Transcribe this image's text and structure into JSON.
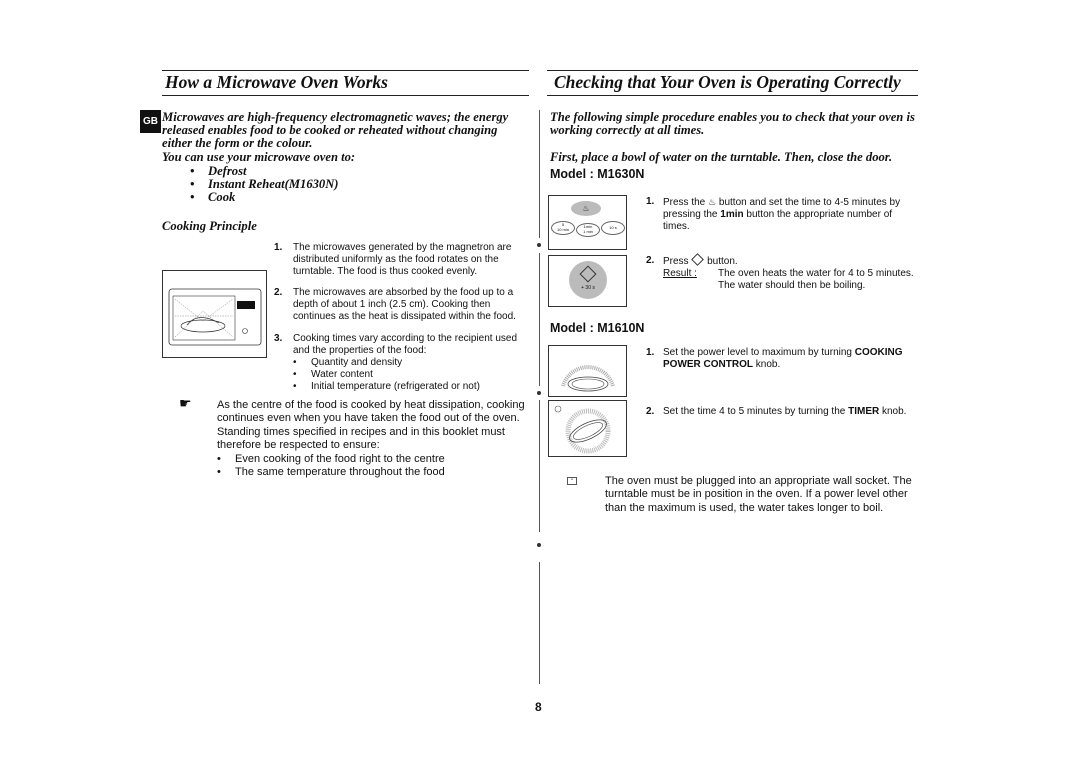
{
  "lang_badge": "GB",
  "left": {
    "title": "How a Microwave Oven Works",
    "intro": [
      "Microwaves are high-frequency electromagnetic waves; the energy",
      "released enables food to be cooked or reheated without changing",
      "either the form or the colour."
    ],
    "uses_heading": "You can use your microwave oven to:",
    "uses": [
      "Defrost",
      "Instant Reheat(M1630N)",
      "Cook"
    ],
    "subheading": "Cooking Principle",
    "steps": [
      {
        "num": "1.",
        "lines": [
          "The microwaves generated by the magnetron are",
          "distributed uniformly as the food rotates on the",
          "turntable. The food is thus cooked evenly."
        ]
      },
      {
        "num": "2.",
        "lines": [
          "The microwaves are absorbed by the food up to a",
          "depth of about 1 inch (2.5 cm). Cooking then",
          "continues as the heat is dissipated within the food."
        ]
      },
      {
        "num": "3.",
        "lines": [
          "Cooking times vary according to the recipient used",
          "and the properties of the food:"
        ],
        "bullets": [
          "Quantity and density",
          "Water content",
          "Initial temperature (refrigerated or not)"
        ]
      }
    ],
    "note": {
      "icon": "pointing-hand-icon",
      "lines": [
        "As the centre of the food is cooked by heat dissipation, cooking",
        "continues even when you have taken the food out of the oven.",
        "Standing times specified in recipes and in this booklet must",
        "therefore be respected to ensure:"
      ],
      "bullets": [
        "Even cooking of the food right to the centre",
        "The same temperature throughout the food"
      ]
    }
  },
  "right": {
    "title": "Checking that Your Oven is Operating Correctly",
    "intro": [
      "The following simple procedure enables you to check that your oven is",
      "working correctly at all times."
    ],
    "intro2": "First, place a bowl of water on the turntable. Then, close the door.",
    "model1": {
      "heading": "Model : M1630N",
      "panel_labels": {
        "b1": "5\n10 min",
        "b2": "1min\n1 min",
        "b3": "10 s",
        "start": "+ 30 s"
      },
      "step1": {
        "num": "1.",
        "pre": "Press the",
        "post": "button and set the time to 4-5 minutes by",
        "l2a": "pressing the",
        "l2b": "1min",
        "l2c": "button the appropriate number of",
        "l3": "times."
      },
      "step2": {
        "num": "2.",
        "pre": "Press",
        "post": "button.",
        "result_label": "Result :",
        "result": [
          "The oven heats the water for 4 to 5 minutes.",
          "The water should then be boiling."
        ]
      }
    },
    "model2": {
      "heading": "Model : M1610N",
      "step1": {
        "num": "1.",
        "a": "Set the power level to maximum by turning",
        "b": "COOKING",
        "c": "POWER CONTROL",
        "d": "knob."
      },
      "step2": {
        "num": "2.",
        "a": "Set the time 4 to 5 minutes by turning the",
        "b": "TIMER",
        "c": "knob."
      }
    },
    "note": {
      "icon": "note-icon",
      "lines": [
        "The oven must be plugged into an appropriate wall socket. The",
        "turntable must be in position in the oven. If a power level other",
        "than the maximum is used, the water takes longer to boil."
      ]
    }
  },
  "page_number": "8"
}
